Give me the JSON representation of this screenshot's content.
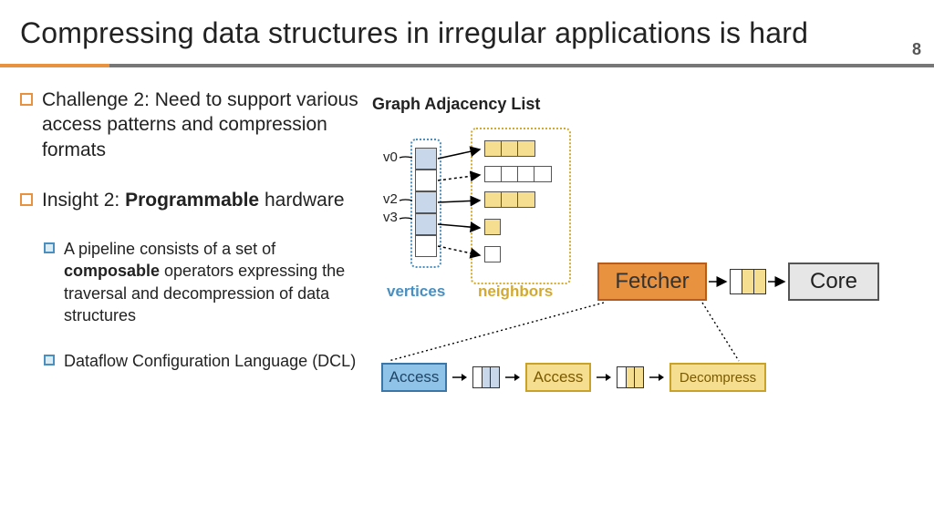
{
  "page_number": "8",
  "title": "Compressing data structures in irregular applications is hard",
  "bullets": {
    "challenge": "Challenge 2: Need to support various access patterns and compression formats",
    "insight_pre": "Insight 2: ",
    "insight_bold": "Programmable",
    "insight_post": " hardware",
    "sub1_a": "A pipeline consists of a set of ",
    "sub1_b": "composable",
    "sub1_c": " operators expressing the traversal and decompression of data structures",
    "sub2": "Dataflow Configuration Language (DCL)"
  },
  "diagram": {
    "title": "Graph Adjacency List",
    "v0": "v0",
    "v2": "v2",
    "v3": "v3",
    "vertices_label": "vertices",
    "neighbors_label": "neighbors",
    "fetcher": "Fetcher",
    "core": "Core"
  },
  "pipeline": {
    "access": "Access",
    "decompress": "Decompress"
  },
  "colors": {
    "orange": "#e8913f",
    "blue": "#4a8fbf",
    "gold": "#d3aa2f"
  }
}
